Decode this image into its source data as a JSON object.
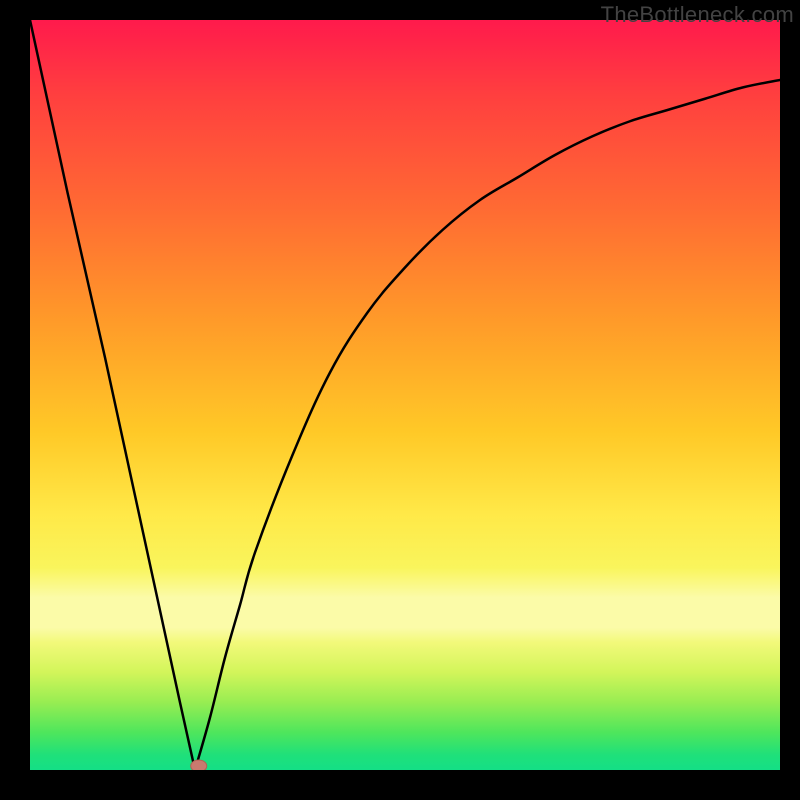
{
  "watermark": "TheBottleneck.com",
  "colors": {
    "frame": "#000000",
    "curve": "#000000",
    "marker_fill": "#c97a6f",
    "marker_stroke": "#b45f53",
    "gradient_top": "#ff1a4c",
    "gradient_bottom": "#14df86"
  },
  "chart_data": {
    "type": "line",
    "title": "",
    "xlabel": "",
    "ylabel": "",
    "xlim": [
      0,
      100
    ],
    "ylim": [
      0,
      100
    ],
    "grid": false,
    "note": "Axes unlabeled — values estimated from plot geometry in percent of plotting area. Curve is a V-shaped bottleneck curve with minimum near x≈22. Left branch is near-linear; right branch is concave rising, saturating toward ~92% at x=100.",
    "x": [
      0,
      5,
      10,
      15,
      20,
      22,
      24,
      26,
      28,
      30,
      35,
      40,
      45,
      50,
      55,
      60,
      65,
      70,
      75,
      80,
      85,
      90,
      95,
      100
    ],
    "y": [
      100,
      77,
      55,
      32,
      9,
      0,
      7,
      15,
      22,
      29,
      42,
      53,
      61,
      67,
      72,
      76,
      79,
      82,
      84.5,
      86.5,
      88,
      89.5,
      91,
      92
    ],
    "marker": {
      "x": 22.5,
      "y": 0,
      "shape": "ellipse"
    }
  }
}
